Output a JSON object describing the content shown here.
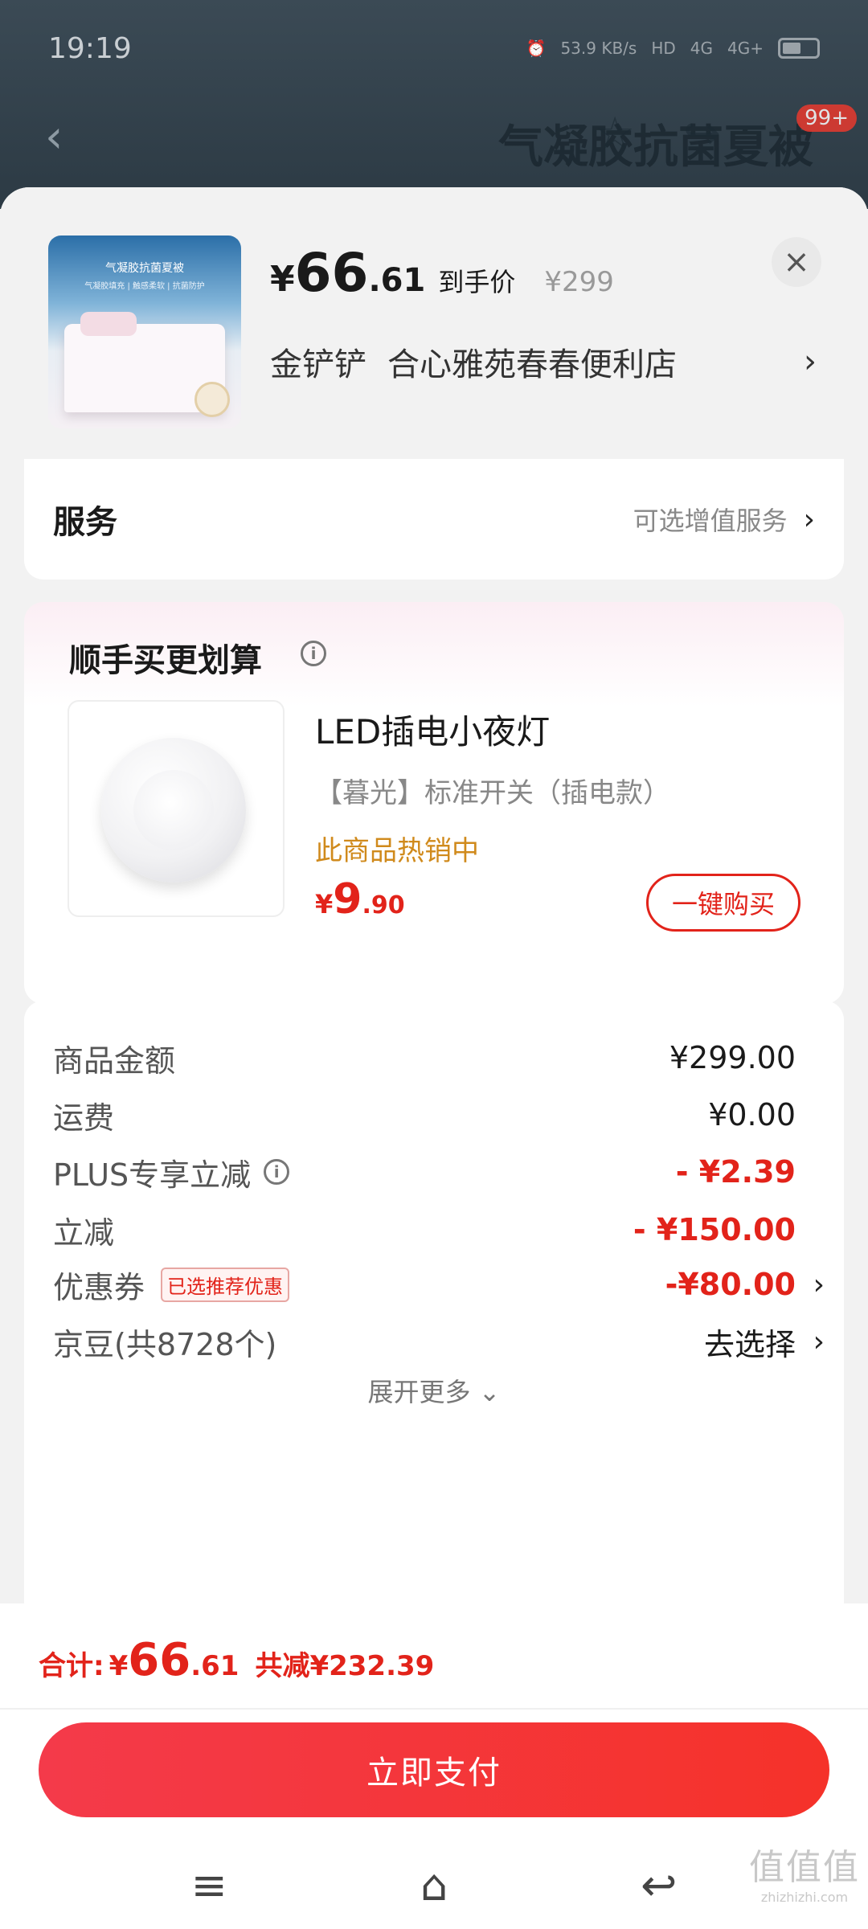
{
  "status": {
    "time": "19:19",
    "net_speed": "53.9 KB/s",
    "signal": [
      "HD",
      "4G",
      "4G+"
    ]
  },
  "bg": {
    "title": "气凝胶抗菌夏被",
    "badge": "99+",
    "back_icon": "back-arrow-icon",
    "star_icon": "star-icon",
    "share_icon": "share-icon"
  },
  "product": {
    "price_symbol": "¥",
    "price_int": "66",
    "price_dec": ".61",
    "price_tag": "到手价",
    "original_price": "¥299",
    "store_owner": "金铲铲",
    "store_name": "合心雅苑春春便利店",
    "thumb_title": "气凝胶抗菌夏被",
    "thumb_sub": "气凝胶填充 | 触感柔软 | 抗菌防护",
    "close": "×",
    "chevron": "›"
  },
  "service": {
    "title": "服务",
    "hint": "可选增值服务",
    "chevron": "›"
  },
  "bundle": {
    "title": "顺手买更划算",
    "info": "i",
    "name": "LED插电小夜灯",
    "spec": "【暮光】标准开关（插电款）",
    "hot": "此商品热销中",
    "price_symbol": "¥",
    "price_int": "9",
    "price_dec": ".90",
    "buy_label": "一键购买"
  },
  "summary": {
    "rows": [
      {
        "label": "商品金额",
        "value": "¥299.00"
      },
      {
        "label": "运费",
        "value": "¥0.00"
      },
      {
        "label": "PLUS专享立减",
        "value": "- ¥2.39"
      },
      {
        "label": "立减",
        "value": "- ¥150.00"
      },
      {
        "label": "优惠券",
        "badge": "已选推荐优惠",
        "value": "-¥80.00"
      },
      {
        "label": "京豆(共8728个)",
        "value": "去选择"
      }
    ],
    "expand": "展开更多 ⌄",
    "chevron": "›",
    "info": "i"
  },
  "footer": {
    "total_label": "合计:",
    "total_symbol": "¥",
    "total_int": "66",
    "total_dec": ".61",
    "total_reduce": "共减¥232.39",
    "pay_label": "立即支付"
  },
  "navbar": {
    "menu": "≡",
    "home": "⌂",
    "back": "↩"
  },
  "watermark": {
    "main": "值值值",
    "sub": "zhizhizhi.com"
  },
  "colors": {
    "accent_red": "#e2231a",
    "hot_orange": "#d08a1c",
    "background": "#f2f2f2"
  }
}
